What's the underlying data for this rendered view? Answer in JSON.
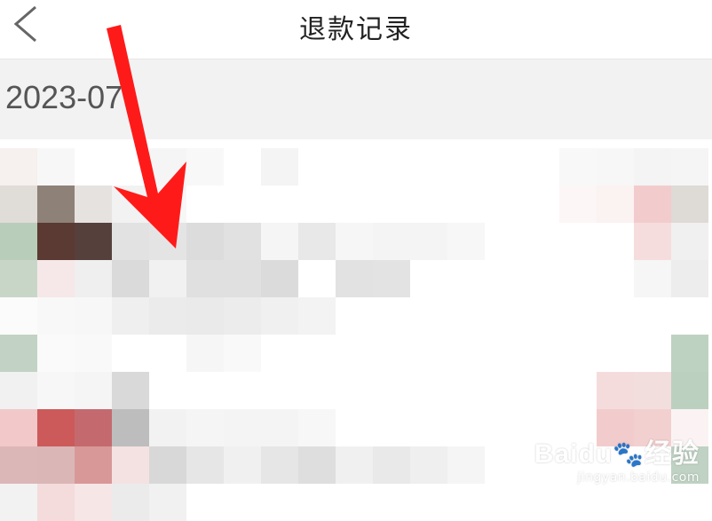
{
  "header": {
    "title": "退款记录",
    "back_icon": "chevron-left-icon"
  },
  "section": {
    "date": "2023-07"
  },
  "watermark": {
    "logo_text": "Baidu",
    "logo_cn": "经验",
    "url": "jingyan.baidu.com",
    "paw_icon": "paw-icon"
  },
  "annotation": {
    "arrow_color": "#ff1a1a"
  }
}
